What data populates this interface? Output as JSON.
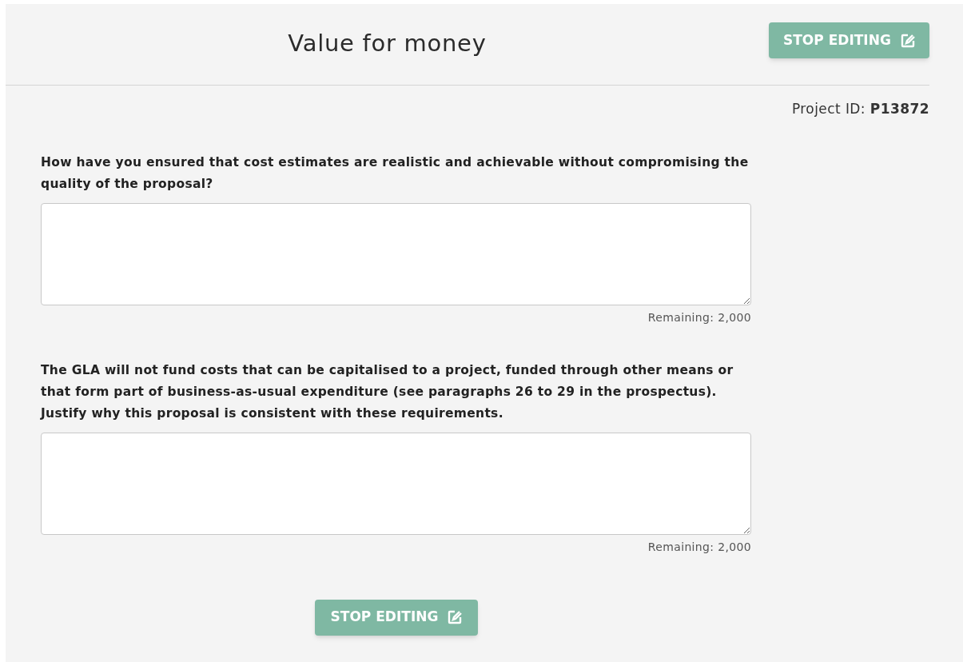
{
  "header": {
    "title": "Value for money",
    "button": "STOP EDITING"
  },
  "project": {
    "label": "Project ID:",
    "id": "P13872"
  },
  "questions": [
    {
      "text": "How have you ensured that cost estimates are realistic and achievable without compromising the quality of the proposal?",
      "remaining": "Remaining: 2,000"
    },
    {
      "text": "The GLA will not fund costs that can be capitalised to a project, funded through other means or that form part of business-as-usual expenditure (see paragraphs 26 to 29 in the prospectus). Justify why this proposal is consistent with these requirements.",
      "remaining": "Remaining: 2,000"
    }
  ],
  "footer": {
    "button": "STOP EDITING"
  }
}
